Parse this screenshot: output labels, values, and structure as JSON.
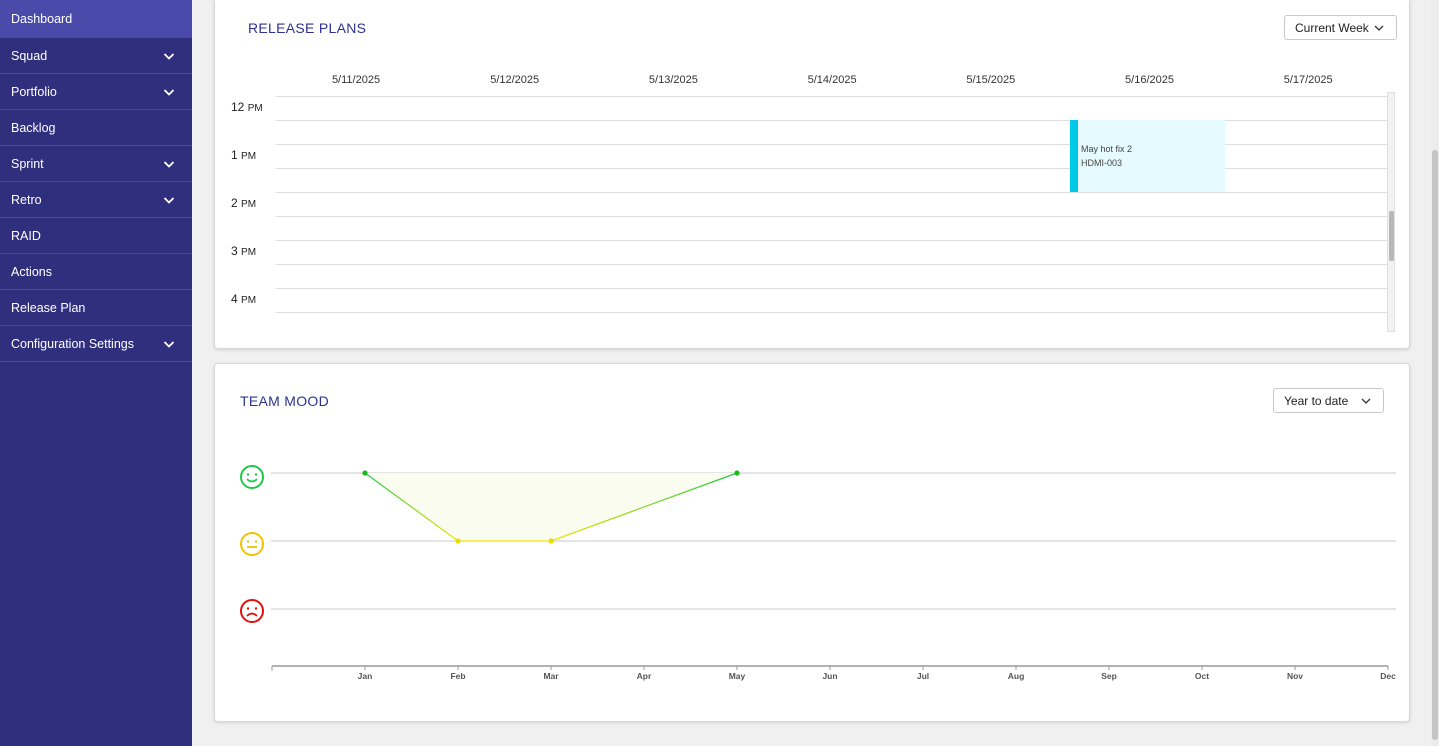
{
  "sidebar": {
    "items": [
      {
        "label": "Dashboard",
        "has_chevron": false,
        "active": true
      },
      {
        "label": "Squad",
        "has_chevron": true,
        "active": false
      },
      {
        "label": "Portfolio",
        "has_chevron": true,
        "active": false
      },
      {
        "label": "Backlog",
        "has_chevron": false,
        "active": false
      },
      {
        "label": "Sprint",
        "has_chevron": true,
        "active": false
      },
      {
        "label": "Retro",
        "has_chevron": true,
        "active": false
      },
      {
        "label": "RAID",
        "has_chevron": false,
        "active": false
      },
      {
        "label": "Actions",
        "has_chevron": false,
        "active": false
      },
      {
        "label": "Release Plan",
        "has_chevron": false,
        "active": false
      },
      {
        "label": "Configuration Settings",
        "has_chevron": true,
        "active": false
      }
    ]
  },
  "release_plans": {
    "title": "RELEASE PLANS",
    "range_select": "Current Week",
    "days": [
      "5/11/2025",
      "5/12/2025",
      "5/13/2025",
      "5/14/2025",
      "5/15/2025",
      "5/16/2025",
      "5/17/2025"
    ],
    "hours": [
      {
        "num": "12",
        "ampm": "PM"
      },
      {
        "num": "1",
        "ampm": "PM"
      },
      {
        "num": "2",
        "ampm": "PM"
      },
      {
        "num": "3",
        "ampm": "PM"
      },
      {
        "num": "4",
        "ampm": "PM"
      }
    ],
    "event": {
      "name": "May hot fix 2",
      "code": "HDMI-003",
      "day": "5/16/2025",
      "start": "12:30 PM",
      "end": "2:00 PM",
      "color": "#00c8e8"
    }
  },
  "team_mood": {
    "title": "TEAM MOOD",
    "range_select": "Year to date",
    "faces": [
      {
        "icon": "happy-face-icon",
        "color": "#1ec84a"
      },
      {
        "icon": "neutral-face-icon",
        "color": "#f2c200"
      },
      {
        "icon": "sad-face-icon",
        "color": "#e01010"
      }
    ],
    "chart_data": {
      "type": "line",
      "categories": [
        "Jan",
        "Feb",
        "Mar",
        "Apr",
        "May",
        "Jun",
        "Jul",
        "Aug",
        "Sep",
        "Oct",
        "Nov",
        "Dec"
      ],
      "series": [
        {
          "values": [
            3,
            2,
            2,
            null,
            3,
            null,
            null,
            null,
            null,
            null,
            null,
            null
          ]
        }
      ],
      "ylim": [
        1,
        3
      ],
      "y_levels": [
        "sad",
        "neutral",
        "happy"
      ],
      "colors": {
        "happy": "#1ec84a",
        "neutral": "#f2e600",
        "grid": "#c8c8c8"
      }
    }
  }
}
